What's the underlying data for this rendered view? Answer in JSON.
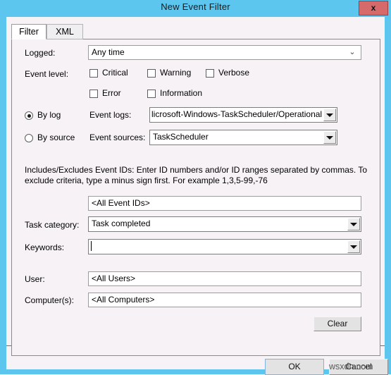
{
  "window": {
    "title": "New Event Filter",
    "close_label": "x"
  },
  "tabs": [
    {
      "label": "Filter",
      "active": true
    },
    {
      "label": "XML",
      "active": false
    }
  ],
  "form": {
    "logged": {
      "label": "Logged:",
      "value": "Any time"
    },
    "event_level": {
      "label": "Event level:",
      "checkboxes": [
        {
          "label": "Critical",
          "checked": false
        },
        {
          "label": "Warning",
          "checked": false
        },
        {
          "label": "Verbose",
          "checked": false
        },
        {
          "label": "Error",
          "checked": false
        },
        {
          "label": "Information",
          "checked": false
        }
      ]
    },
    "source_mode": {
      "by_log_label": "By log",
      "by_source_label": "By source",
      "selected": "by_log"
    },
    "event_logs": {
      "label": "Event logs:",
      "value": "licrosoft-Windows-TaskScheduler/Operational"
    },
    "event_sources": {
      "label": "Event sources:",
      "value": "TaskScheduler"
    },
    "event_ids_hint": "Includes/Excludes Event IDs: Enter ID numbers and/or ID ranges separated by commas. To exclude criteria, type a minus sign first. For example 1,3,5-99,-76",
    "event_ids": {
      "value": "<All Event IDs>"
    },
    "task_category": {
      "label": "Task category:",
      "value": "Task completed"
    },
    "keywords": {
      "label": "Keywords:",
      "value": ""
    },
    "user": {
      "label": "User:",
      "value": "<All Users>"
    },
    "computers": {
      "label": "Computer(s):",
      "value": "<All Computers>"
    },
    "clear_button": "Clear"
  },
  "footer": {
    "ok_label": "OK",
    "cancel_label": "Cancel"
  },
  "watermark": {
    "text": "wsxdn.com"
  },
  "colors": {
    "titlebar": "#5cc6ef",
    "dialog_bg": "#f6f2f6",
    "close_button": "#d66a6a",
    "panel_border": "#8d8a8d"
  }
}
